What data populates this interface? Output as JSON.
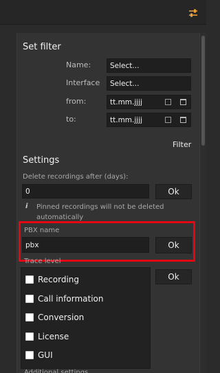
{
  "set_filter": {
    "title": "Set filter",
    "name_label": "Name:",
    "name_value": "Select...",
    "interface_label": "Interface",
    "interface_value": "Select...",
    "from_label": "from:",
    "from_placeholder": "tt.mm.jjjj",
    "to_label": "to:",
    "to_placeholder": "tt.mm.jjjj",
    "filter_button": "Filter"
  },
  "settings": {
    "title": "Settings",
    "delete_label": "Delete recordings after (days):",
    "delete_value": "0",
    "ok": "Ok",
    "info_icon": "i",
    "info_text": "Pinned recordings will not be deleted automatically",
    "pbx_label": "PBX name",
    "pbx_value": "pbx",
    "trace_label": "Trace level",
    "trace_options": [
      "Recording",
      "Call information",
      "Conversion",
      "License",
      "GUI"
    ],
    "additional_label": "Additional settings"
  },
  "icons": {
    "settings_toggle": "sliders-icon",
    "info": "info-icon",
    "calendar": "calendar-icon"
  },
  "colors": {
    "highlight": "#e30613",
    "panel": "#333333",
    "field": "#1f1f1f"
  }
}
